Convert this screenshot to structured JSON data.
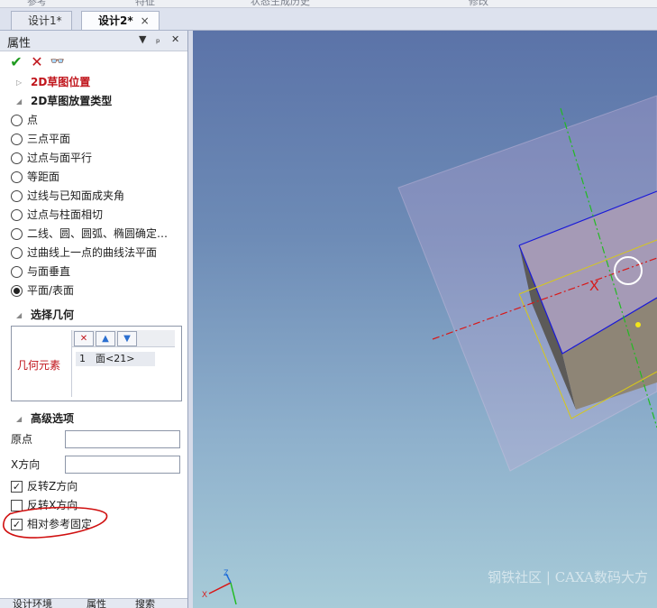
{
  "top_strip": [
    "参考",
    "特征",
    "状态生成历史",
    "修改"
  ],
  "doc_tabs": [
    {
      "label": "设计1*",
      "active": false
    },
    {
      "label": "设计2*",
      "active": true,
      "close": "×"
    }
  ],
  "panel": {
    "title": "属性",
    "controls": [
      "▼",
      "ₚ",
      "✕"
    ],
    "sections": {
      "position": "2D草图位置",
      "placement_type": "2D草图放置类型",
      "select_geometry": "选择几何",
      "advanced": "高级选项"
    },
    "placement_options": [
      {
        "label": "点",
        "selected": false
      },
      {
        "label": "三点平面",
        "selected": false
      },
      {
        "label": "过点与面平行",
        "selected": false
      },
      {
        "label": "等距面",
        "selected": false
      },
      {
        "label": "过线与已知面成夹角",
        "selected": false
      },
      {
        "label": "过点与柱面相切",
        "selected": false
      },
      {
        "label": "二线、圆、圆弧、椭圆确定…",
        "selected": false
      },
      {
        "label": "过曲线上一点的曲线法平面",
        "selected": false
      },
      {
        "label": "与面垂直",
        "selected": false
      },
      {
        "label": "平面/表面",
        "selected": true
      }
    ],
    "geometry": {
      "label": "几何元素",
      "item_index": "1",
      "item_value": "面<21>"
    },
    "advanced_fields": [
      {
        "label": "原点",
        "value": ""
      },
      {
        "label": "X方向",
        "value": ""
      }
    ],
    "checkboxes": [
      {
        "label": "反转Z方向",
        "checked": true
      },
      {
        "label": "反转X方向",
        "checked": false
      },
      {
        "label": "相对参考固定",
        "checked": true
      }
    ],
    "bottom_tabs": [
      "设计环境",
      "属性",
      "搜索"
    ]
  },
  "viewport": {
    "axis_marker": "X",
    "triad": {
      "z": "Z",
      "x": "X"
    },
    "watermark": "钢铁社区 | CAXA数码大方"
  },
  "colors": {
    "accent_red": "#c0141b",
    "ok_green": "#1f9a1f"
  }
}
